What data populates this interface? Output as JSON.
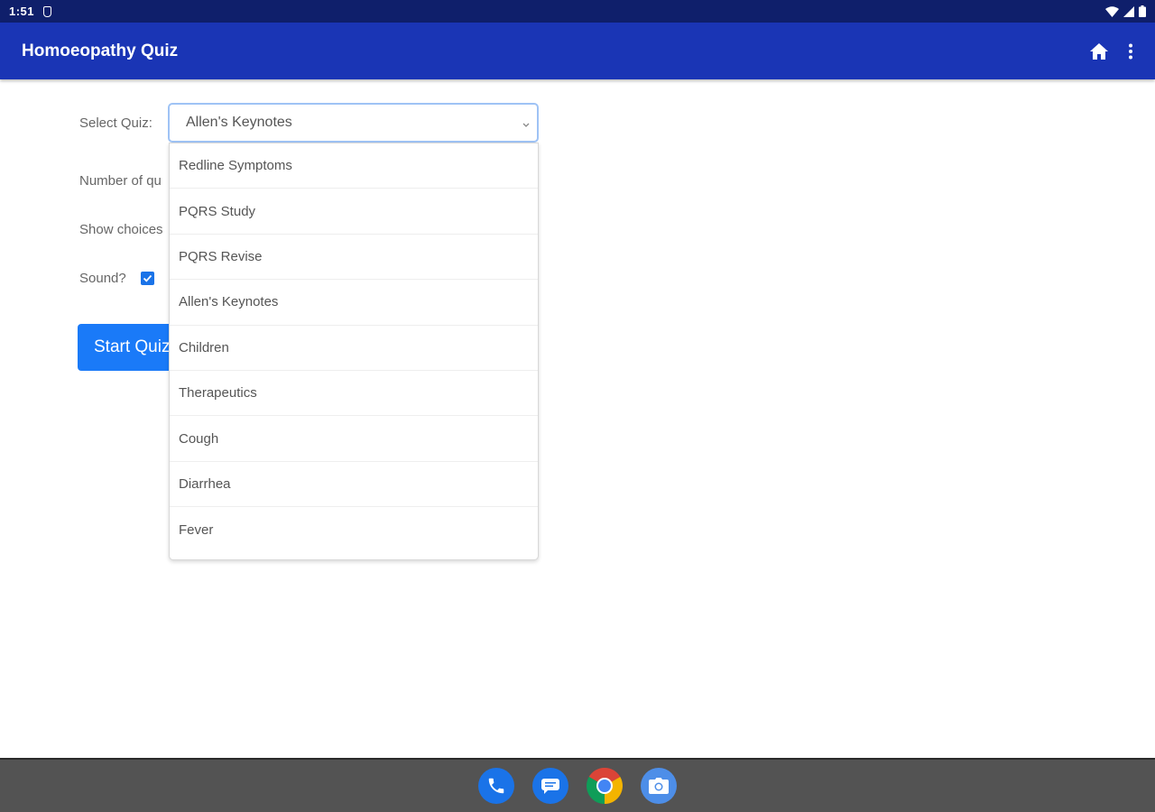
{
  "status_bar": {
    "time": "1:51"
  },
  "app_bar": {
    "title": "Homoeopathy Quiz"
  },
  "form": {
    "select_label": "Select Quiz:",
    "selected_quiz": "Allen's Keynotes",
    "number_label": "Number of qu",
    "choices_label": "Show choices",
    "sound_label": "Sound?",
    "sound_checked": true,
    "start_label": "Start Quiz"
  },
  "dropdown": {
    "options": [
      "Redline Symptoms",
      "PQRS Study",
      "PQRS Revise",
      "Allen's Keynotes",
      "Children",
      "Therapeutics",
      "Cough",
      "Diarrhea",
      "Fever"
    ]
  },
  "nav_bar": {
    "icons": [
      "phone-icon",
      "messages-icon",
      "chrome-icon",
      "camera-icon"
    ]
  },
  "colors": {
    "status_bar": "#0f1f6b",
    "app_bar": "#1a35b5",
    "primary_button": "#1a7af8",
    "nav_bar": "#535353"
  }
}
